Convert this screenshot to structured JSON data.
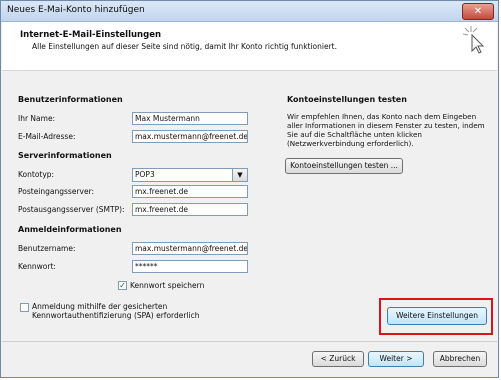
{
  "window": {
    "title": "Neues E-Mai-Konto hinzufügen",
    "close_icon": "close-icon"
  },
  "header": {
    "title": "Internet-E-Mail-Einstellungen",
    "subtitle": "Alle Einstellungen auf dieser Seite sind nötig, damit Ihr Konto richtig funktioniert."
  },
  "user": {
    "section": "Benutzerinformationen",
    "name_label": "Ihr Name:",
    "name_value": "Max Mustermann",
    "email_label": "E-Mail-Adresse:",
    "email_value": "max.mustermann@freenet.de"
  },
  "server": {
    "section": "Serverinformationen",
    "type_label": "Kontotyp:",
    "type_value": "POP3",
    "incoming_label": "Posteingangsserver:",
    "incoming_value": "mx.freenet.de",
    "outgoing_label": "Postausgangsserver (SMTP):",
    "outgoing_value": "mx.freenet.de"
  },
  "login": {
    "section": "Anmeldeinformationen",
    "username_label": "Benutzername:",
    "username_value": "max.mustermann@freenet.de",
    "password_label": "Kennwort:",
    "password_value": "******",
    "remember_label": "Kennwort speichern",
    "remember_checked": true,
    "spa_label": "Anmeldung mithilfe der gesicherten Kennwortauthentifizierung (SPA) erforderlich",
    "spa_checked": false
  },
  "test": {
    "section": "Kontoeinstellungen testen",
    "description": "Wir empfehlen Ihnen, das Konto nach dem Eingeben aller Informationen in diesem Fenster zu testen, indem Sie auf die Schaltfläche unten klicken (Netzwerkverbindung erforderlich).",
    "button": "Kontoeinstellungen testen ..."
  },
  "more_settings": "Weitere Einstellungen",
  "nav": {
    "back": "< Zurück",
    "next": "Weiter >",
    "cancel": "Abbrechen"
  }
}
